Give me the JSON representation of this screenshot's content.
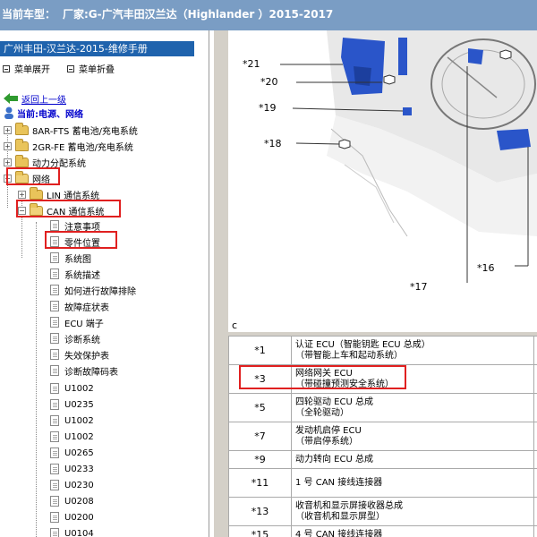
{
  "title_bar": {
    "prefix": "当前车型：",
    "manufacturer": "厂家:G-广汽丰田汉兰达（Highlander ）2015-2017"
  },
  "sidebar": {
    "manual_title": "广州丰田-汉兰达-2015-维修手册",
    "expand_menu": "菜单展开",
    "collapse_menu": "菜单折叠",
    "back_link": "返回上一级",
    "current_location": "当前:电源、网络",
    "tree": [
      {
        "label": "8AR-FTS 蓄电池/充电系统",
        "kind": "folder"
      },
      {
        "label": "2GR-FE 蓄电池/充电系统",
        "kind": "folder"
      },
      {
        "label": "动力分配系统",
        "kind": "folder"
      },
      {
        "label": "网络",
        "kind": "folder-open"
      },
      {
        "label": "LIN 通信系统",
        "kind": "folder"
      },
      {
        "label": "CAN 通信系统",
        "kind": "folder-open"
      },
      {
        "label": "注意事项",
        "kind": "doc"
      },
      {
        "label": "零件位置",
        "kind": "doc"
      },
      {
        "label": "系统图",
        "kind": "doc"
      },
      {
        "label": "系统描述",
        "kind": "doc"
      },
      {
        "label": "如何进行故障排除",
        "kind": "doc"
      },
      {
        "label": "故障症状表",
        "kind": "doc"
      },
      {
        "label": "ECU 端子",
        "kind": "doc"
      },
      {
        "label": "诊断系统",
        "kind": "doc"
      },
      {
        "label": "失效保护表",
        "kind": "doc"
      },
      {
        "label": "诊断故障码表",
        "kind": "doc"
      },
      {
        "label": "U1002",
        "kind": "doc"
      },
      {
        "label": "U0235",
        "kind": "doc"
      },
      {
        "label": "U1002",
        "kind": "doc"
      },
      {
        "label": "U1002",
        "kind": "doc"
      },
      {
        "label": "U0265",
        "kind": "doc"
      },
      {
        "label": "U0233",
        "kind": "doc"
      },
      {
        "label": "U0230",
        "kind": "doc"
      },
      {
        "label": "U0208",
        "kind": "doc"
      },
      {
        "label": "U0200",
        "kind": "doc"
      },
      {
        "label": "U0104",
        "kind": "doc"
      }
    ]
  },
  "diagram": {
    "callouts": [
      "*21",
      "*20",
      "*19",
      "*18",
      "*17",
      "*16"
    ],
    "label": "c",
    "colors": {
      "ecu_blue": "#2a55c9",
      "highlight_red": "#e02020"
    }
  },
  "parts_table": {
    "rows": [
      {
        "code": "*1",
        "name": "认证 ECU（智能钥匙 ECU 总成）",
        "sub": "（带智能上车和起动系统）"
      },
      {
        "code": "*3",
        "name": "网络网关 ECU",
        "sub": "（带碰撞预测安全系统）"
      },
      {
        "code": "*5",
        "name": "四轮驱动 ECU 总成",
        "sub": "（全轮驱动）"
      },
      {
        "code": "*7",
        "name": "发动机启停 ECU",
        "sub": "（带启停系统）"
      },
      {
        "code": "*9",
        "name": "动力转向 ECU 总成",
        "sub": ""
      },
      {
        "code": "*11",
        "name": "1 号 CAN 接线连接器",
        "sub": ""
      },
      {
        "code": "*13",
        "name": "收音机和显示屏接收器总成",
        "sub": "（收音机和显示屏型）"
      },
      {
        "code": "*15",
        "name": "4 号 CAN 接线连接器",
        "sub": ""
      }
    ]
  }
}
